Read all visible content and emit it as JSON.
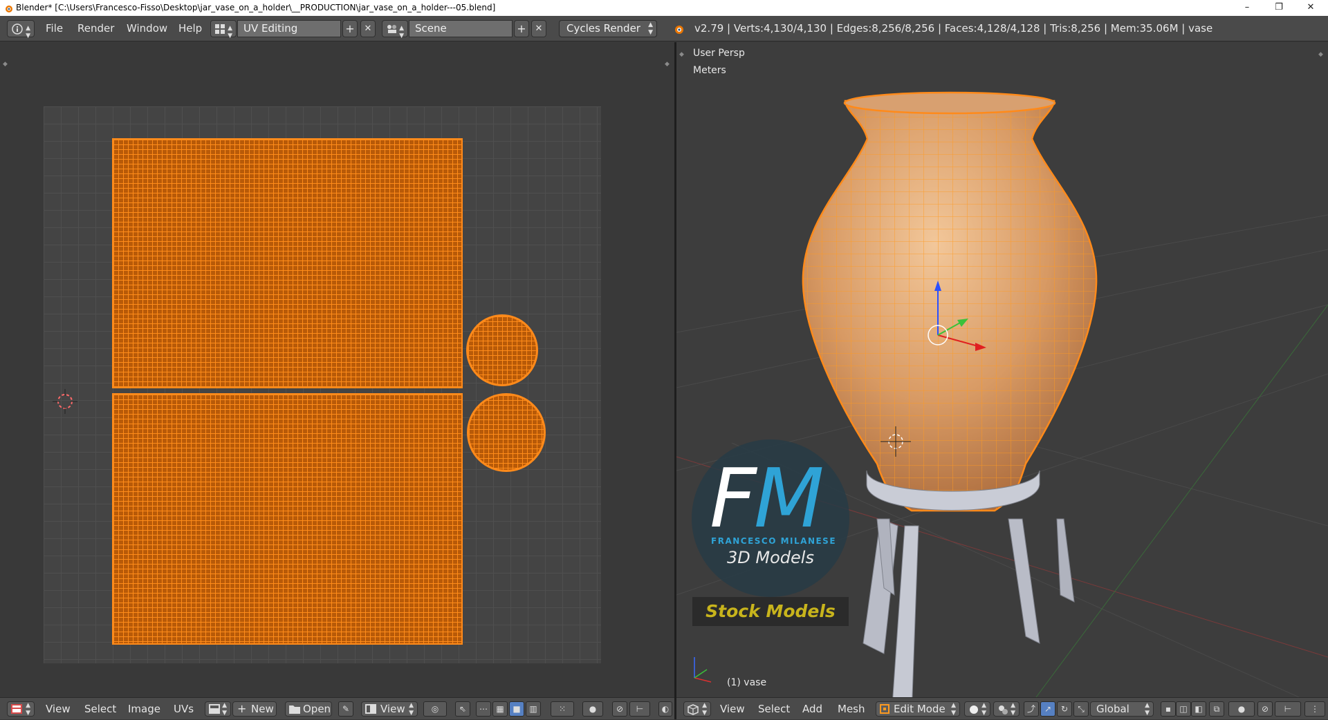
{
  "window": {
    "title": "Blender* [C:\\Users\\Francesco-Fisso\\Desktop\\jar_vase_on_a_holder\\__PRODUCTION\\jar_vase_on_a_holder---05.blend]",
    "minimize": "–",
    "restore": "❐",
    "close": "✕"
  },
  "topbar": {
    "info_icon": "i",
    "menus": [
      "File",
      "Render",
      "Window",
      "Help"
    ],
    "screen_layout": "UV Editing",
    "scene": "Scene",
    "render_engine": "Cycles Render",
    "stats": "v2.79 | Verts:4,130/4,130 | Edges:8,256/8,256 | Faces:4,128/4,128 | Tris:8,256 | Mem:35.06M | vase",
    "add_glyph": "+",
    "remove_glyph": "✕"
  },
  "uv_editor": {
    "menus": [
      "View",
      "Select",
      "Image",
      "UVs"
    ],
    "new_label": "New",
    "open_label": "Open",
    "view_label": "View"
  },
  "viewport": {
    "view_name": "User Persp",
    "units": "Meters",
    "object_label": "(1) vase",
    "menus": [
      "View",
      "Select",
      "Add",
      "Mesh"
    ],
    "mode": "Edit Mode",
    "orientation": "Global"
  },
  "watermark": {
    "letter_f": "F",
    "letter_m": "M",
    "author": "FRANCESCO MILANESE",
    "subtitle": "3D Models",
    "badge": "Stock Models"
  },
  "colors": {
    "selection_orange": "#ff8a1a",
    "header_bg": "#4a4a4a",
    "editor_bg": "#393939",
    "brand_blue": "#2fa3d6",
    "badge_yellow": "#c8b41c"
  }
}
